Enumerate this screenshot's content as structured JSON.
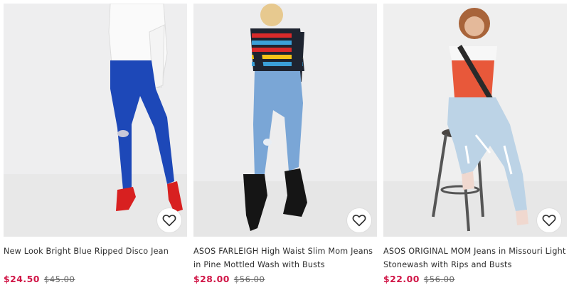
{
  "products": [
    {
      "title": "New Look Bright Blue Ripped Disco Jean",
      "sale_price": "$24.50",
      "original_price": "$45.00"
    },
    {
      "title": "ASOS FARLEIGH High Waist Slim Mom Jeans in Pine Mottled Wash with Busts",
      "sale_price": "$28.00",
      "original_price": "$56.00"
    },
    {
      "title": "ASOS ORIGINAL MOM Jeans in Missouri Light Stonewash with Rips and Busts",
      "sale_price": "$22.00",
      "original_price": "$56.00"
    }
  ],
  "colors": {
    "sale_price": "#d01345",
    "original_price": "#666666",
    "photo_background": "#eceded"
  },
  "icons": {
    "wishlist": "heart-outline-icon"
  }
}
